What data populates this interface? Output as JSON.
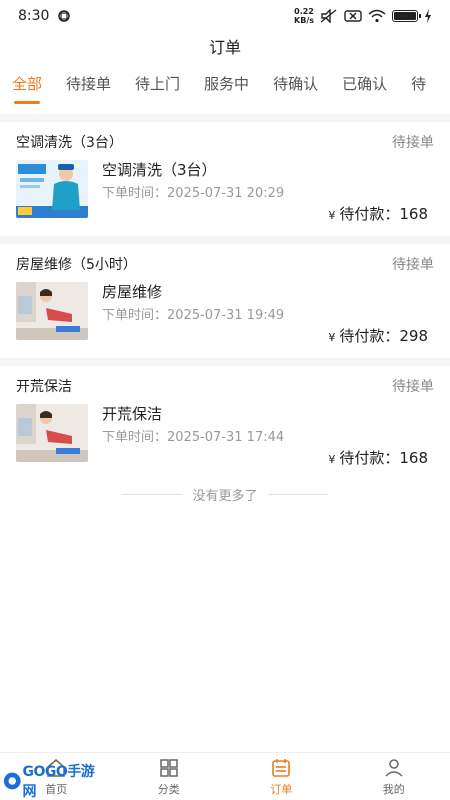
{
  "status_bar": {
    "time": "8:30",
    "net_speed_value": "0.22",
    "net_speed_unit": "KB/s"
  },
  "nav": {
    "title": "订单"
  },
  "tabs": [
    {
      "label": "全部",
      "active": true
    },
    {
      "label": "待接单"
    },
    {
      "label": "待上门"
    },
    {
      "label": "服务中"
    },
    {
      "label": "待确认"
    },
    {
      "label": "已确认"
    },
    {
      "label": "待"
    }
  ],
  "orders": [
    {
      "title": "空调清洗（3台）",
      "status": "待接单",
      "name": "空调清洗（3台）",
      "time_label": "下单时间：2025-07-31 20:29",
      "price_symbol": "¥",
      "price_text": "待付款：168"
    },
    {
      "title": "房屋维修（5小时）",
      "status": "待接单",
      "name": "房屋维修",
      "time_label": "下单时间：2025-07-31 19:49",
      "price_symbol": "¥",
      "price_text": "待付款：298"
    },
    {
      "title": "开荒保洁",
      "status": "待接单",
      "name": "开荒保洁",
      "time_label": "下单时间：2025-07-31 17:44",
      "price_symbol": "¥",
      "price_text": "待付款：168"
    }
  ],
  "no_more_text": "没有更多了",
  "bottom_nav": [
    {
      "label": "首页",
      "icon": "home-icon"
    },
    {
      "label": "分类",
      "icon": "grid-icon"
    },
    {
      "label": "订单",
      "icon": "order-icon",
      "active": true
    },
    {
      "label": "我的",
      "icon": "user-icon"
    }
  ],
  "colors": {
    "accent": "#f07a1e",
    "muted": "#999999",
    "bg_gray": "#f5f5f7"
  },
  "watermark": {
    "text": "GOGO手游网"
  }
}
